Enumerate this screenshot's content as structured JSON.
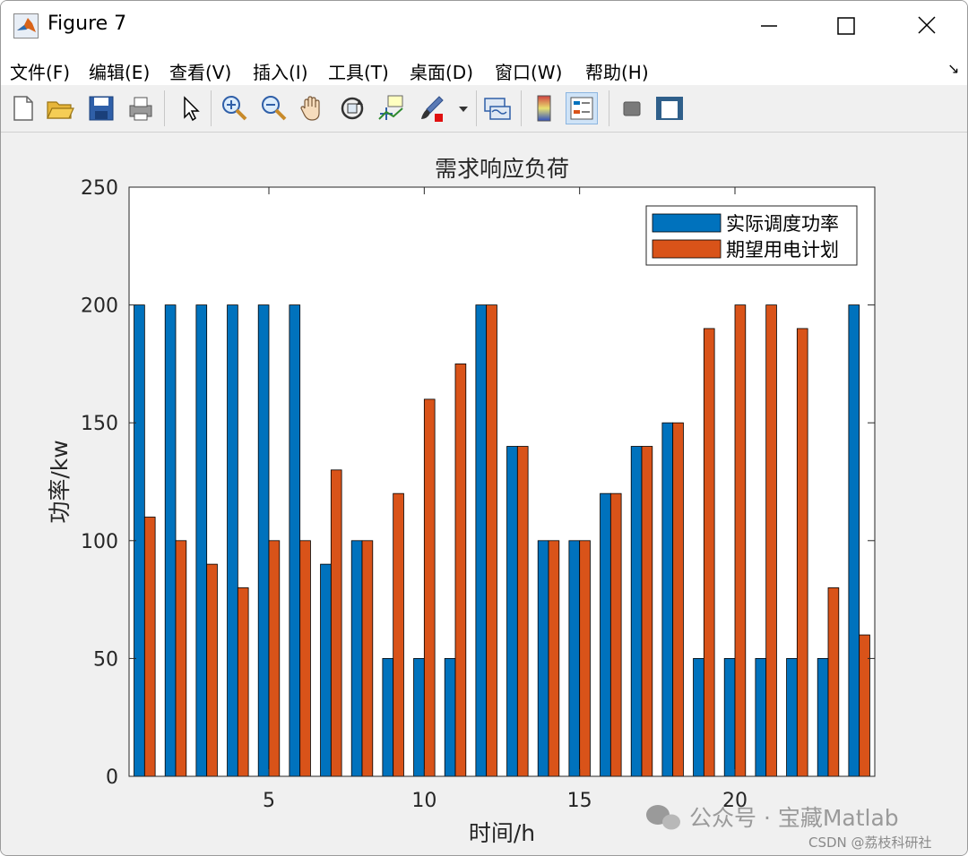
{
  "window": {
    "title": "Figure 7"
  },
  "menu": [
    "文件(F)",
    "编辑(E)",
    "查看(V)",
    "插入(I)",
    "工具(T)",
    "桌面(D)",
    "窗口(W)",
    "帮助(H)"
  ],
  "toolbar": [
    {
      "name": "new-figure-icon"
    },
    {
      "name": "open-file-icon"
    },
    {
      "name": "save-icon"
    },
    {
      "name": "print-icon"
    },
    {
      "name": "pointer-icon"
    },
    {
      "name": "zoom-in-icon"
    },
    {
      "name": "zoom-out-icon"
    },
    {
      "name": "pan-hand-icon"
    },
    {
      "name": "rotate-3d-icon"
    },
    {
      "name": "data-cursor-icon"
    },
    {
      "name": "brush-icon"
    },
    {
      "name": "link-plot-icon"
    },
    {
      "name": "colorbar-icon"
    },
    {
      "name": "legend-icon",
      "active": true
    },
    {
      "name": "hide-plot-tools-icon"
    },
    {
      "name": "show-plot-tools-icon"
    }
  ],
  "chart_data": {
    "type": "bar",
    "title": "需求响应负荷",
    "xlabel": "时间/h",
    "ylabel": "功率/kw",
    "x": [
      1,
      2,
      3,
      4,
      5,
      6,
      7,
      8,
      9,
      10,
      11,
      12,
      13,
      14,
      15,
      16,
      17,
      18,
      19,
      20,
      21,
      22,
      23,
      24
    ],
    "xticks": [
      5,
      10,
      15,
      20
    ],
    "xlim": [
      0.5,
      24.5
    ],
    "yticks": [
      0,
      50,
      100,
      150,
      200,
      250
    ],
    "ylim": [
      0,
      250
    ],
    "legend_position": "top-right",
    "series": [
      {
        "name": "实际调度功率",
        "color": "#0072BD",
        "values": [
          200,
          200,
          200,
          200,
          200,
          200,
          90,
          100,
          50,
          50,
          50,
          200,
          140,
          100,
          100,
          120,
          140,
          150,
          50,
          50,
          50,
          50,
          50,
          200
        ]
      },
      {
        "name": "期望用电计划",
        "color": "#D95319",
        "values": [
          110,
          100,
          90,
          80,
          100,
          100,
          130,
          100,
          120,
          160,
          175,
          200,
          140,
          100,
          100,
          120,
          140,
          150,
          190,
          200,
          200,
          190,
          80,
          60
        ]
      }
    ]
  },
  "watermark": {
    "main": "公众号 · 宝藏Matlab",
    "sub": "CSDN @荔枝科研社"
  }
}
